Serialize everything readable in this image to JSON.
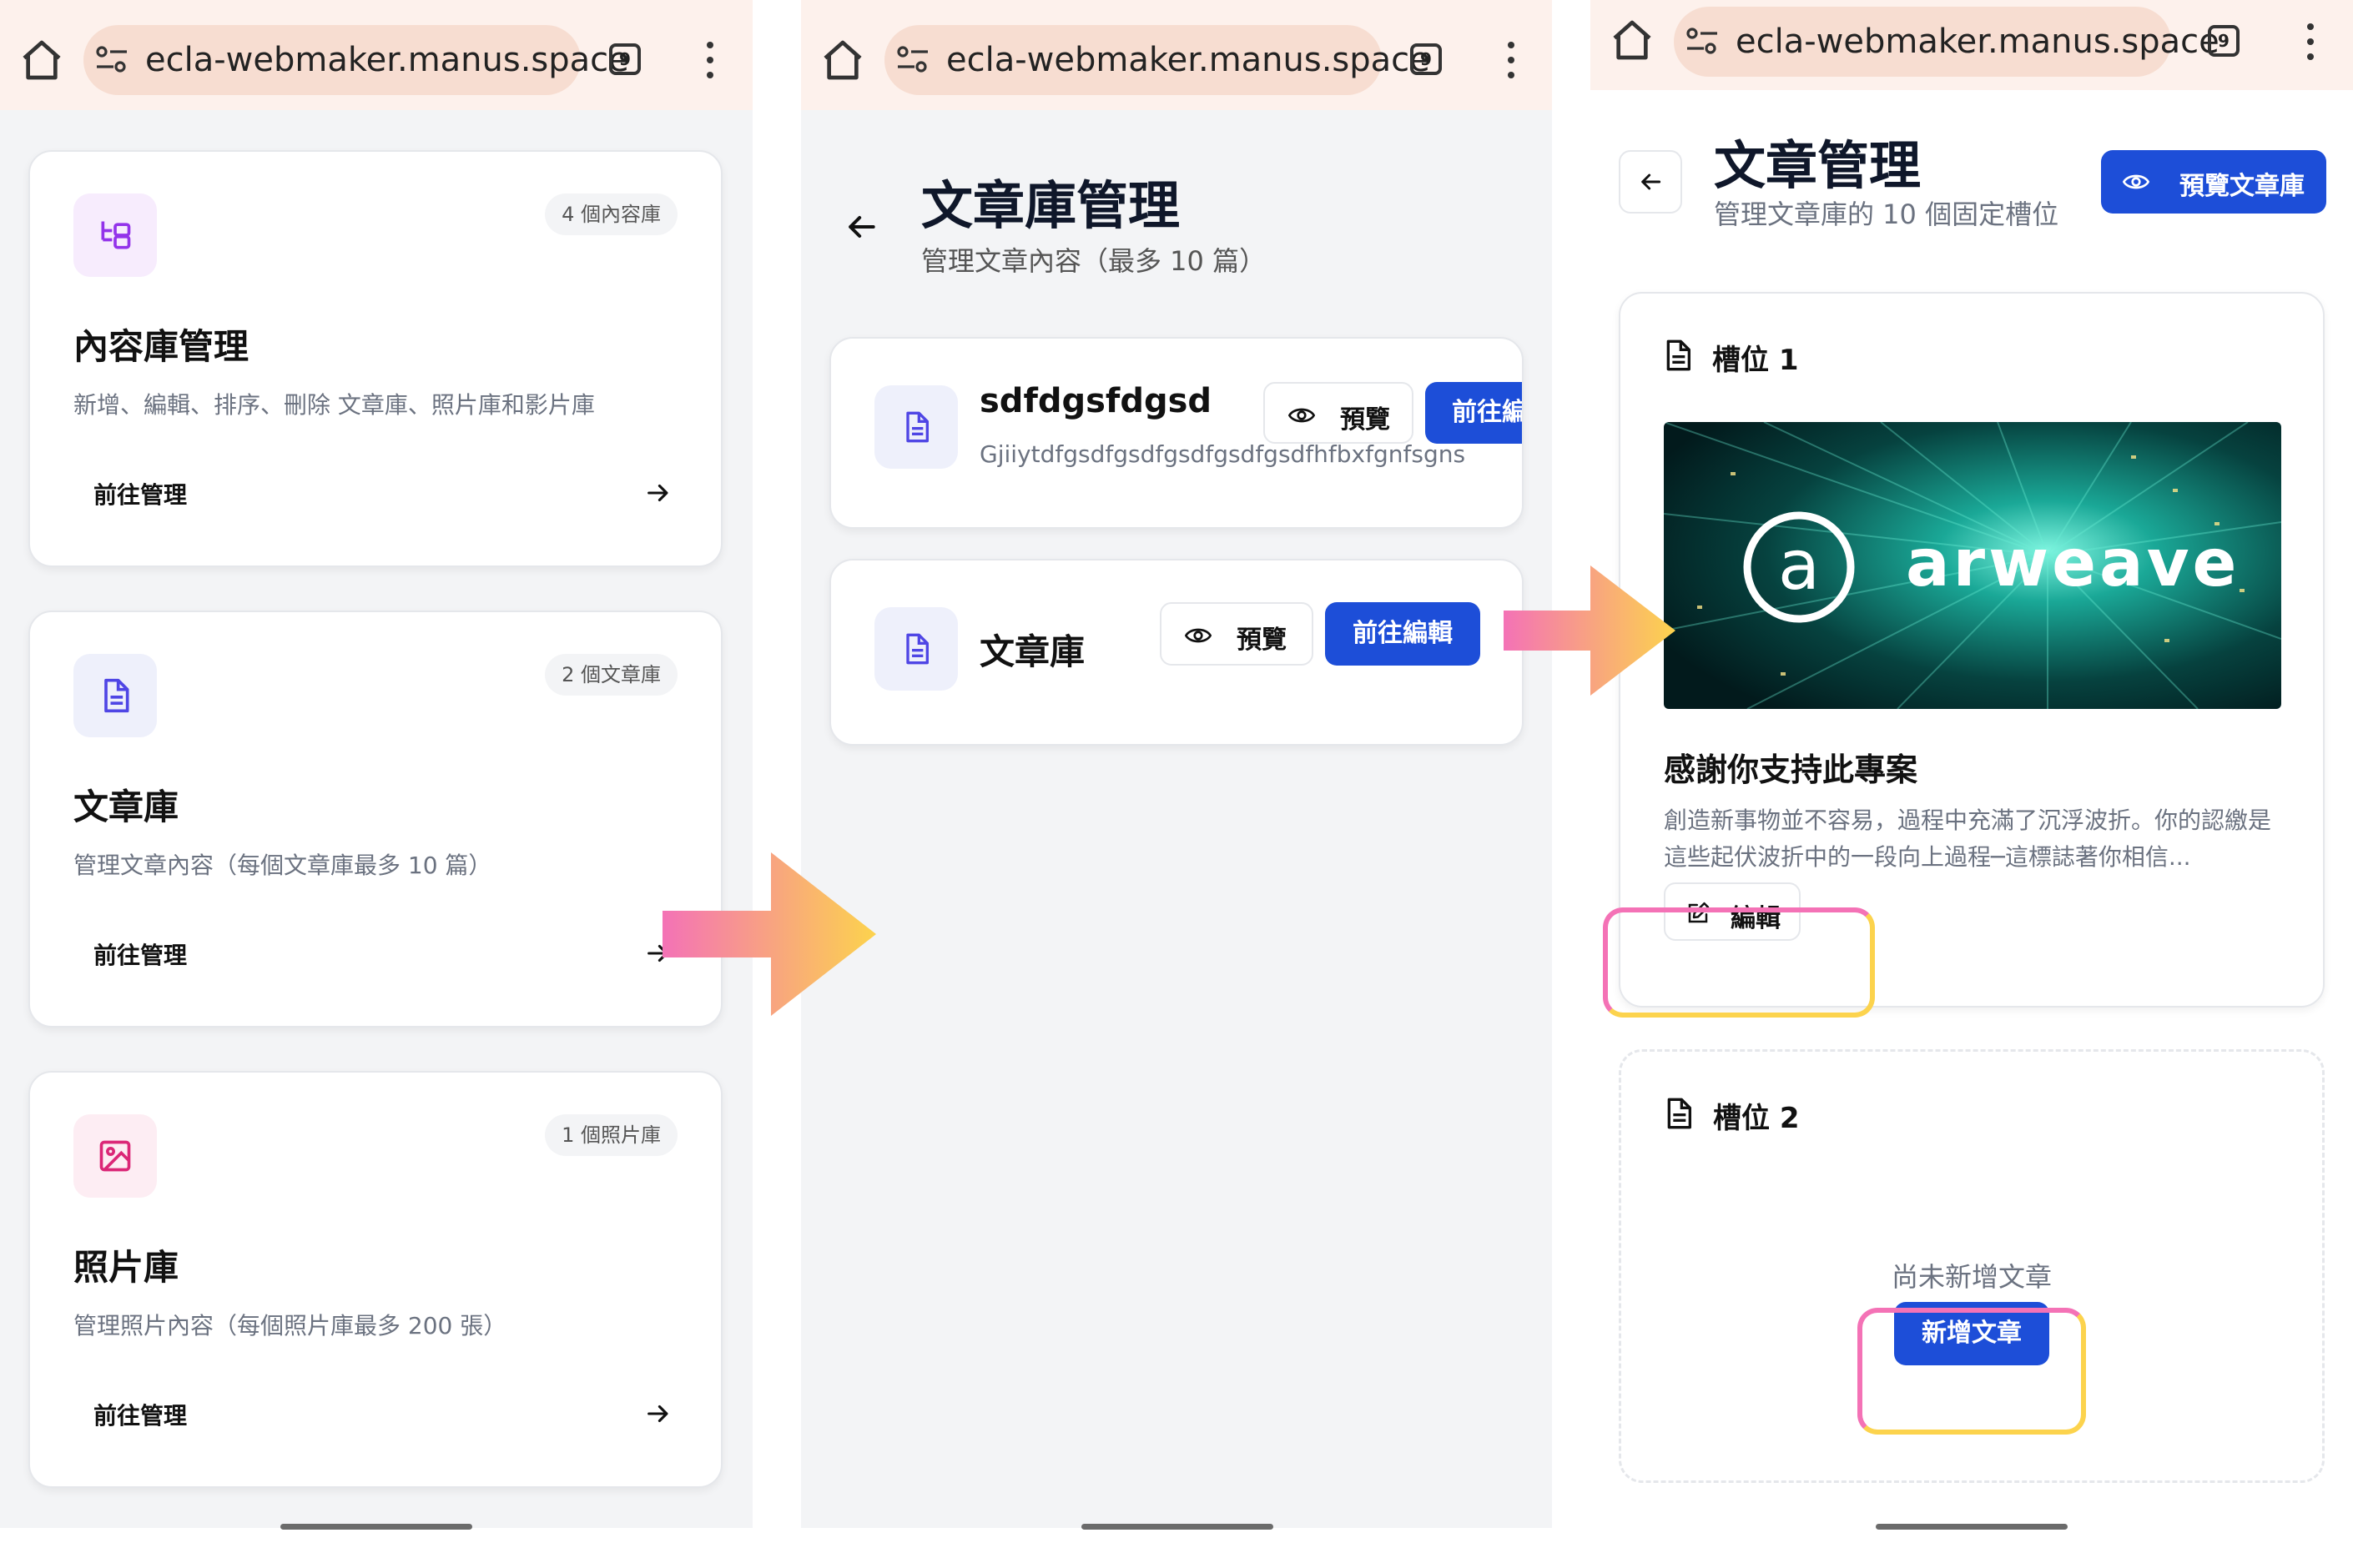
{
  "browser": {
    "url": "ecla-webmaker.manus.space",
    "tab_count": "9"
  },
  "panel1": {
    "cards": [
      {
        "badge": "4 個內容庫",
        "title": "內容庫管理",
        "desc": "新增、編輯、排序、刪除 文章庫、照片庫和影片庫",
        "action": "前往管理",
        "icon": "folder-tree-icon",
        "accent": "#9333ea",
        "icon_bg": "#f7ecfd"
      },
      {
        "badge": "2 個文章庫",
        "title": "文章庫",
        "desc": "管理文章內容（每個文章庫最多 10 篇）",
        "action": "前往管理",
        "icon": "document-icon",
        "accent": "#4f46e5",
        "icon_bg": "#eef0fb"
      },
      {
        "badge": "1 個照片庫",
        "title": "照片庫",
        "desc": "管理照片內容（每個照片庫最多 200 張）",
        "action": "前往管理",
        "icon": "image-icon",
        "accent": "#db2777",
        "icon_bg": "#fdedf3"
      }
    ]
  },
  "panel2": {
    "title": "文章庫管理",
    "subtitle": "管理文章內容（最多 10 篇）",
    "items": [
      {
        "name": "sdfdgsfdgsd",
        "desc": "Gjiiytdfgsdfgsdfgsdfgsdfgsdfhfbxfgnfsgns",
        "preview_label": "預覽",
        "edit_label": "前往編輯"
      },
      {
        "name": "文章庫",
        "desc": "",
        "preview_label": "預覽",
        "edit_label": "前往編輯"
      }
    ]
  },
  "panel3": {
    "title": "文章管理",
    "subtitle": "管理文章庫的 10 個固定槽位",
    "preview_button": "預覽文章庫",
    "slots": [
      {
        "label": "槽位 1",
        "article_title": "感謝你支持此專案",
        "excerpt": "創造新事物並不容易，過程中充滿了沉浮波折。你的認繳是這些起伏波折中的一段向上過程─這標誌著你相信...",
        "banner_text": "arweave",
        "edit_label": "編輯"
      },
      {
        "label": "槽位 2",
        "empty_text": "尚未新增文章",
        "add_label": "新增文章"
      }
    ]
  },
  "colors": {
    "primary": "#1d4ed8",
    "highlight_pink": "#f472b6",
    "highlight_yellow": "#fcd34d",
    "browser_bar": "#fdf1ec"
  }
}
